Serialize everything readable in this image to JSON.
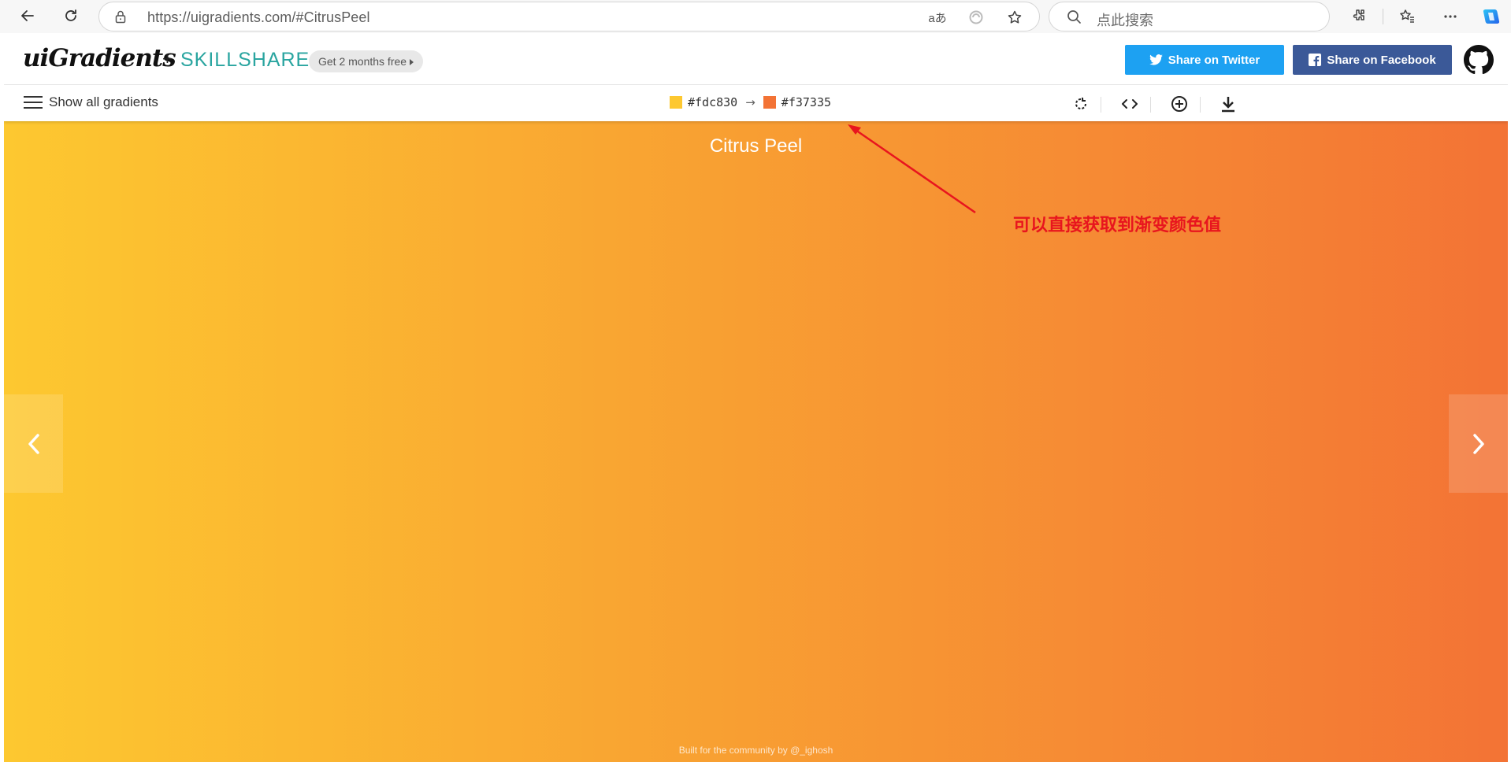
{
  "browser": {
    "url": "https://uigradients.com/#CitrusPeel",
    "search_placeholder": "点此搜索",
    "read_aloud_label": "aあ"
  },
  "header": {
    "logo_text": "uiGradients",
    "plus": "+",
    "skillshare": "SKILLSHARE",
    "promo_label": "Get 2 months free",
    "twitter_label": "Share on Twitter",
    "facebook_label": "Share on Facebook"
  },
  "toolbar": {
    "menu_label": "Show all gradients",
    "color_from": "#fdc830",
    "color_to": "#f37335",
    "arrow": "→"
  },
  "gradient": {
    "name": "Citrus Peel",
    "start_color": "#fdc830",
    "end_color": "#f37335",
    "footer": "Built for the community by @_ighosh"
  },
  "annotation": {
    "text": "可以直接获取到渐变颜色值",
    "color": "#e8151e"
  },
  "colors": {
    "twitter": "#1da1f2",
    "facebook": "#3b5998",
    "skillshare": "#2aa5a0"
  }
}
